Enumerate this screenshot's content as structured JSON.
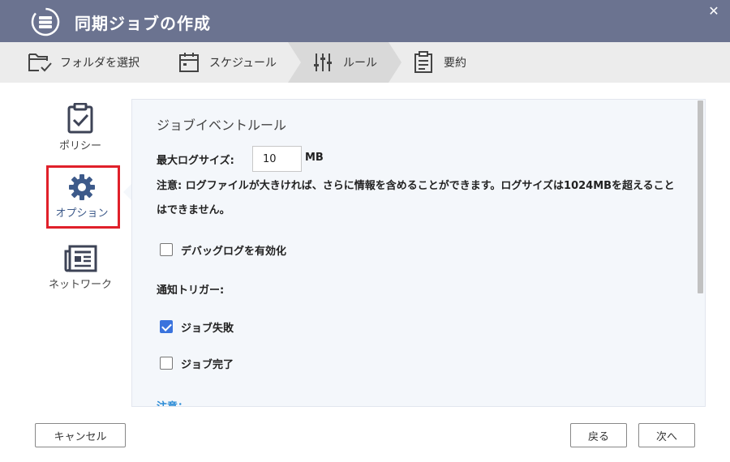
{
  "window": {
    "title": "同期ジョブの作成",
    "close_symbol": "✕"
  },
  "steps": [
    {
      "label": "フォルダを選択",
      "icon": "folder-check-icon"
    },
    {
      "label": "スケジュール",
      "icon": "calendar-icon"
    },
    {
      "label": "ルール",
      "icon": "sliders-icon",
      "active": true
    },
    {
      "label": "要約",
      "icon": "clipboard-list-icon"
    }
  ],
  "sidebar": {
    "items": [
      {
        "label": "ポリシー",
        "icon": "clipboard-check-icon"
      },
      {
        "label": "オプション",
        "icon": "gear-icon",
        "selected": true
      },
      {
        "label": "ネットワーク",
        "icon": "newspaper-icon"
      }
    ]
  },
  "panel": {
    "section_title": "ジョブイベントルール",
    "max_log_label": "最大ログサイズ:",
    "max_log_value": "10",
    "max_log_unit": "MB",
    "note": "注意: ログファイルが大きければ、さらに情報を含めることができます。ログサイズは1024MBを超えることはできません。",
    "debug_log_label": "デバッグログを有効化",
    "debug_log_checked": false,
    "notify_trigger_label": "通知トリガー:",
    "job_failed_label": "ジョブ失敗",
    "job_failed_checked": true,
    "job_complete_label": "ジョブ完了",
    "job_complete_checked": false,
    "bottom_note_label": "注意："
  },
  "footer": {
    "cancel_label": "キャンセル",
    "back_label": "戻る",
    "next_label": "次へ"
  },
  "colors": {
    "titlebar": "#6b7390",
    "highlight": "#e0202a",
    "checkbox_checked": "#3a73dd",
    "link": "#2a8bd6"
  }
}
